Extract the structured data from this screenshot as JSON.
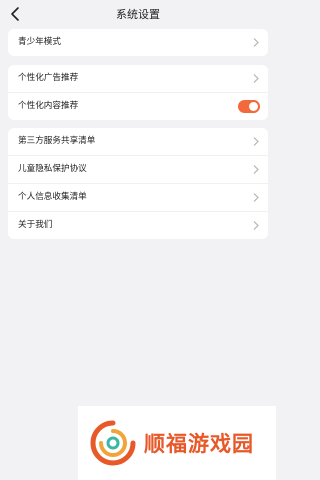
{
  "header": {
    "title": "系统设置",
    "back_icon": "back-arrow-icon"
  },
  "groups": [
    {
      "items": [
        {
          "label": "青少年模式",
          "type": "link"
        }
      ]
    },
    {
      "items": [
        {
          "label": "个性化广告推荐",
          "type": "link"
        },
        {
          "label": "个性化内容推荐",
          "type": "toggle",
          "on": true
        }
      ]
    },
    {
      "items": [
        {
          "label": "第三方服务共享清单",
          "type": "link"
        },
        {
          "label": "儿童隐私保护协议",
          "type": "link"
        },
        {
          "label": "个人信息收集清单",
          "type": "link"
        },
        {
          "label": "关于我们",
          "type": "link"
        }
      ]
    }
  ],
  "colors": {
    "accent": "#f26a3b",
    "watermark": "#e8592a"
  },
  "watermark": {
    "text": "顺福游戏园"
  }
}
